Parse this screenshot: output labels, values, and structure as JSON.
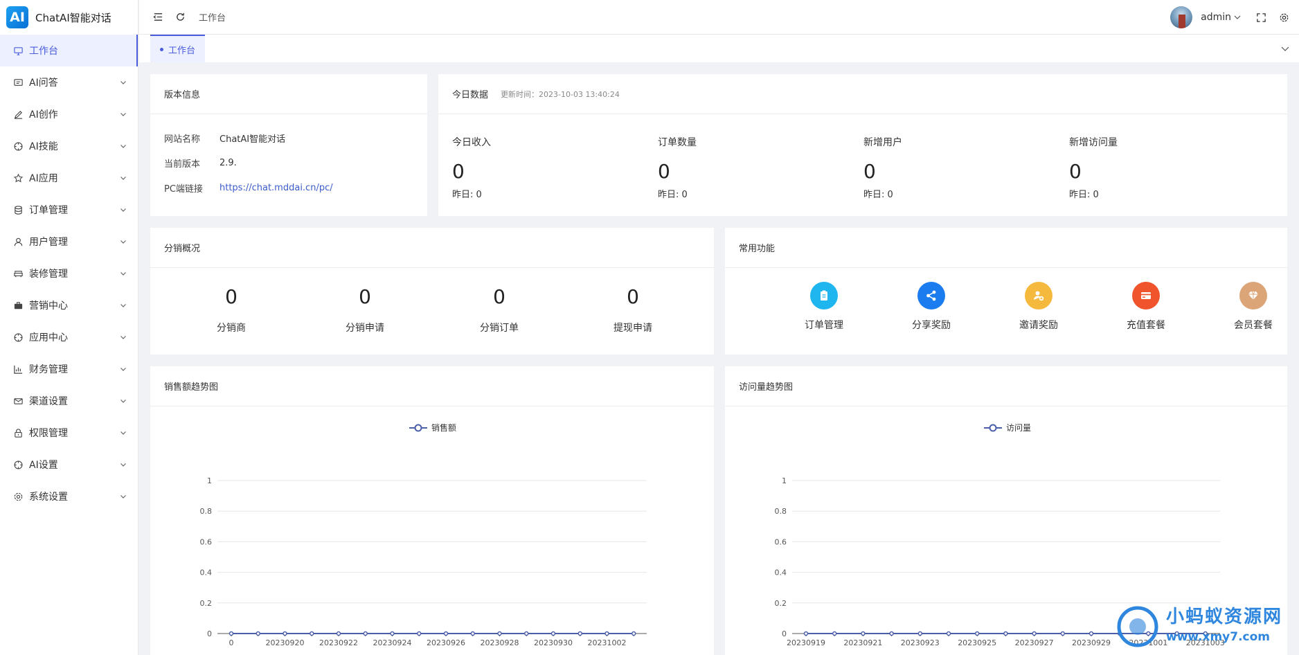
{
  "app": {
    "logo": "AI",
    "title": "ChatAI智能对话"
  },
  "sidebar": {
    "items": [
      {
        "label": "工作台",
        "icon": "monitor-icon",
        "active": true
      },
      {
        "label": "AI问答",
        "icon": "message-icon"
      },
      {
        "label": "AI创作",
        "icon": "pen-icon"
      },
      {
        "label": "AI技能",
        "icon": "target-icon"
      },
      {
        "label": "AI应用",
        "icon": "star-icon"
      },
      {
        "label": "订单管理",
        "icon": "database-icon"
      },
      {
        "label": "用户管理",
        "icon": "user-icon"
      },
      {
        "label": "装修管理",
        "icon": "sofa-icon"
      },
      {
        "label": "营销中心",
        "icon": "briefcase-icon"
      },
      {
        "label": "应用中心",
        "icon": "target-icon"
      },
      {
        "label": "财务管理",
        "icon": "chart-icon"
      },
      {
        "label": "渠道设置",
        "icon": "mail-icon"
      },
      {
        "label": "权限管理",
        "icon": "lock-icon"
      },
      {
        "label": "AI设置",
        "icon": "target-icon"
      },
      {
        "label": "系统设置",
        "icon": "gear-icon"
      }
    ]
  },
  "header": {
    "breadcrumb": "工作台",
    "username": "admin"
  },
  "tabs": [
    {
      "label": "工作台"
    }
  ],
  "version": {
    "title": "版本信息",
    "rows": [
      {
        "key": "网站名称",
        "value": "ChatAI智能对话"
      },
      {
        "key": "当前版本",
        "value": "2.9."
      },
      {
        "key": "PC端链接",
        "value": "https://chat.mddai.cn/pc/"
      }
    ]
  },
  "today": {
    "title": "今日数据",
    "updated": "更新时间：2023-10-03 13:40:24",
    "stats": [
      {
        "label": "今日收入",
        "value": "0",
        "yesterday": "昨日: 0"
      },
      {
        "label": "订单数量",
        "value": "0",
        "yesterday": "昨日: 0"
      },
      {
        "label": "新增用户",
        "value": "0",
        "yesterday": "昨日: 0"
      },
      {
        "label": "新增访问量",
        "value": "0",
        "yesterday": "昨日: 0"
      }
    ]
  },
  "distribution": {
    "title": "分销概况",
    "items": [
      {
        "label": "分销商",
        "value": "0"
      },
      {
        "label": "分销申请",
        "value": "0"
      },
      {
        "label": "分销订单",
        "value": "0"
      },
      {
        "label": "提现申请",
        "value": "0"
      }
    ]
  },
  "functions": {
    "title": "常用功能",
    "items": [
      {
        "label": "订单管理",
        "icon": "clipboard-icon",
        "color": "#1fb6f0"
      },
      {
        "label": "分享奖励",
        "icon": "share-icon",
        "color": "#1b7cf0"
      },
      {
        "label": "邀请奖励",
        "icon": "invite-user-icon",
        "color": "#f5b93e"
      },
      {
        "label": "充值套餐",
        "icon": "card-icon",
        "color": "#f0542d"
      },
      {
        "label": "会员套餐",
        "icon": "diamond-icon",
        "color": "#dca578"
      }
    ]
  },
  "charts": {
    "sales_title": "销售额趋势图",
    "visits_title": "访问量趋势图",
    "line_color": "#4a5fa8"
  },
  "chart_data": [
    {
      "type": "line",
      "legend": "top-center",
      "x": [
        "0",
        "20230919",
        "20230920",
        "20230921",
        "20230922",
        "20230923",
        "20230924",
        "20230925",
        "20230926",
        "20230927",
        "20230928",
        "20230929",
        "20230930",
        "20231001",
        "20231002",
        "20231003"
      ],
      "x_tick_labels": [
        "0",
        "20230920",
        "20230922",
        "20230924",
        "20230926",
        "20230928",
        "20230930",
        "20231002"
      ],
      "series": [
        {
          "name": "销售额",
          "values": [
            0,
            0,
            0,
            0,
            0,
            0,
            0,
            0,
            0,
            0,
            0,
            0,
            0,
            0,
            0,
            0
          ]
        }
      ],
      "ylim": [
        0,
        1
      ],
      "yticks": [
        "0",
        "0.2",
        "0.4",
        "0.6",
        "0.8",
        "1"
      ],
      "grid": true
    },
    {
      "type": "line",
      "legend": "top-center",
      "x": [
        "20230919",
        "20230920",
        "20230921",
        "20230922",
        "20230923",
        "20230924",
        "20230925",
        "20230926",
        "20230927",
        "20230928",
        "20230929",
        "20230930",
        "20231001",
        "20231002",
        "20231003"
      ],
      "x_tick_labels": [
        "20230919",
        "20230921",
        "20230923",
        "20230925",
        "20230927",
        "20230929",
        "20231001",
        "20231003"
      ],
      "series": [
        {
          "name": "访问量",
          "values": [
            0,
            0,
            0,
            0,
            0,
            0,
            0,
            0,
            0,
            0,
            0,
            0,
            0,
            0,
            0
          ]
        }
      ],
      "ylim": [
        0,
        1
      ],
      "yticks": [
        "0",
        "0.2",
        "0.4",
        "0.6",
        "0.8",
        "1"
      ],
      "grid": true
    }
  ],
  "watermark": {
    "text": "小蚂蚁资源网",
    "url": "www.xmy7.com"
  }
}
